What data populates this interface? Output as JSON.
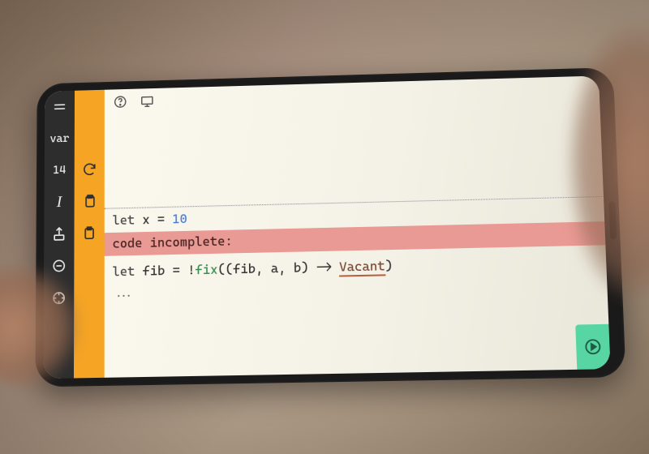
{
  "sidebar": {
    "dark": {
      "menu_label": "=",
      "mode_label": "var",
      "number": "14",
      "italic_label": "I"
    }
  },
  "topbar": {
    "help_tooltip": "Help",
    "display_tooltip": "Display"
  },
  "editor": {
    "line1_let": "let",
    "line1_var": " x = ",
    "line1_val": "10",
    "error_text": "code incomplete:",
    "line2_let": "let",
    "line2_mid1": " fib = !",
    "line2_fn": "fix",
    "line2_mid2": "((fib, a, b) -> ",
    "line2_vacant": "Vacant",
    "line2_end": ")",
    "ellipsis": "..."
  },
  "run": {
    "label": "Run"
  }
}
